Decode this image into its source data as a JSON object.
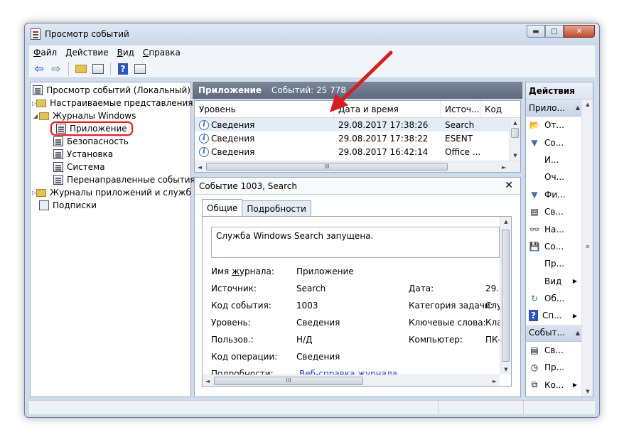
{
  "window": {
    "title": "Просмотр событий",
    "controls": {
      "minimize": "▬",
      "maximize": "□",
      "close": "✕"
    }
  },
  "menu": [
    {
      "label": "Файл",
      "underline": "Ф",
      "rest": "айл"
    },
    {
      "label": "Действие",
      "underline": "Д",
      "rest": "ействие"
    },
    {
      "label": "Вид",
      "underline": "В",
      "rest": "ид"
    },
    {
      "label": "Справка",
      "underline": "С",
      "rest": "правка"
    }
  ],
  "toolbar": [
    "back-icon",
    "forward-icon",
    "folder-up-icon",
    "console-tree-icon",
    "help-icon",
    "action-pane-icon"
  ],
  "tree": {
    "root": "Просмотр событий (Локальный)",
    "custom_views": "Настраиваемые представления",
    "windows_logs": "Журналы Windows",
    "logs": [
      {
        "label": "Приложение",
        "selected": true
      },
      {
        "label": "Безопасность"
      },
      {
        "label": "Установка"
      },
      {
        "label": "Система"
      },
      {
        "label": "Перенаправленные события"
      }
    ],
    "app_service_logs": "Журналы приложений и служб",
    "subscriptions": "Подписки"
  },
  "center": {
    "log_name": "Приложение",
    "event_count": "Событий: 25 778",
    "columns": [
      "Уровень",
      "Дата и время",
      "Источ...",
      "Код"
    ],
    "rows": [
      {
        "level": "Сведения",
        "datetime": "29.08.2017 17:38:26",
        "source": "Search",
        "code": ""
      },
      {
        "level": "Сведения",
        "datetime": "29.08.2017 17:38:22",
        "source": "ESENT",
        "code": ""
      },
      {
        "level": "Сведения",
        "datetime": "29.08.2017 16:42:14",
        "source": "Office ...",
        "code": ""
      }
    ]
  },
  "detail": {
    "title": "Событие 1003, Search",
    "close": "✕",
    "tabs": [
      "Общие",
      "Подробности"
    ],
    "message": "Служба Windows Search запущена.",
    "fields": {
      "log_name_label": "Имя журнала:",
      "log_name": "Приложение",
      "source_label": "Источник:",
      "source": "Search",
      "event_id_label": "Код события:",
      "event_id": "1003",
      "level_label": "Уровень:",
      "level": "Сведения",
      "user_label": "Пользов.:",
      "user": "Н/Д",
      "opcode_label": "Код операции:",
      "opcode": "Сведения",
      "details_label": "Подробности:",
      "details_link": "Веб-справка журнала ",
      "date_label": "Дата:",
      "date": "29.0",
      "task_label": "Категория задачи:",
      "task": "Слу",
      "keywords_label": "Ключевые слова:",
      "keywords": "Кла",
      "computer_label": "Компьютер:",
      "computer": "ПК-"
    }
  },
  "actions": {
    "title": "Действия",
    "section1": "Прило...",
    "items1": [
      {
        "icon": "open-log-icon",
        "label": "От..."
      },
      {
        "icon": "filter-create-icon",
        "label": "Со..."
      },
      {
        "icon": "",
        "label": "И..."
      },
      {
        "icon": "",
        "label": "Оч..."
      },
      {
        "icon": "filter-icon",
        "label": "Фи..."
      },
      {
        "icon": "properties-icon",
        "label": "Св..."
      },
      {
        "icon": "find-icon",
        "label": "На..."
      },
      {
        "icon": "save-icon",
        "label": "Со..."
      },
      {
        "icon": "",
        "label": "Пр..."
      },
      {
        "icon": "",
        "label": "Вид",
        "submenu": true
      },
      {
        "icon": "refresh-icon",
        "label": "Об..."
      },
      {
        "icon": "help-icon",
        "label": "Сп...",
        "submenu": true
      }
    ],
    "section2": "Событ...",
    "items2": [
      {
        "icon": "properties-icon",
        "label": "Св..."
      },
      {
        "icon": "attach-task-icon",
        "label": "Пр..."
      },
      {
        "icon": "copy-icon",
        "label": "Ко...",
        "submenu": true
      }
    ]
  },
  "scroll_glyphs": {
    "up": "▲",
    "down": "▼",
    "left": "◄",
    "right": "►",
    "grip": "III"
  }
}
